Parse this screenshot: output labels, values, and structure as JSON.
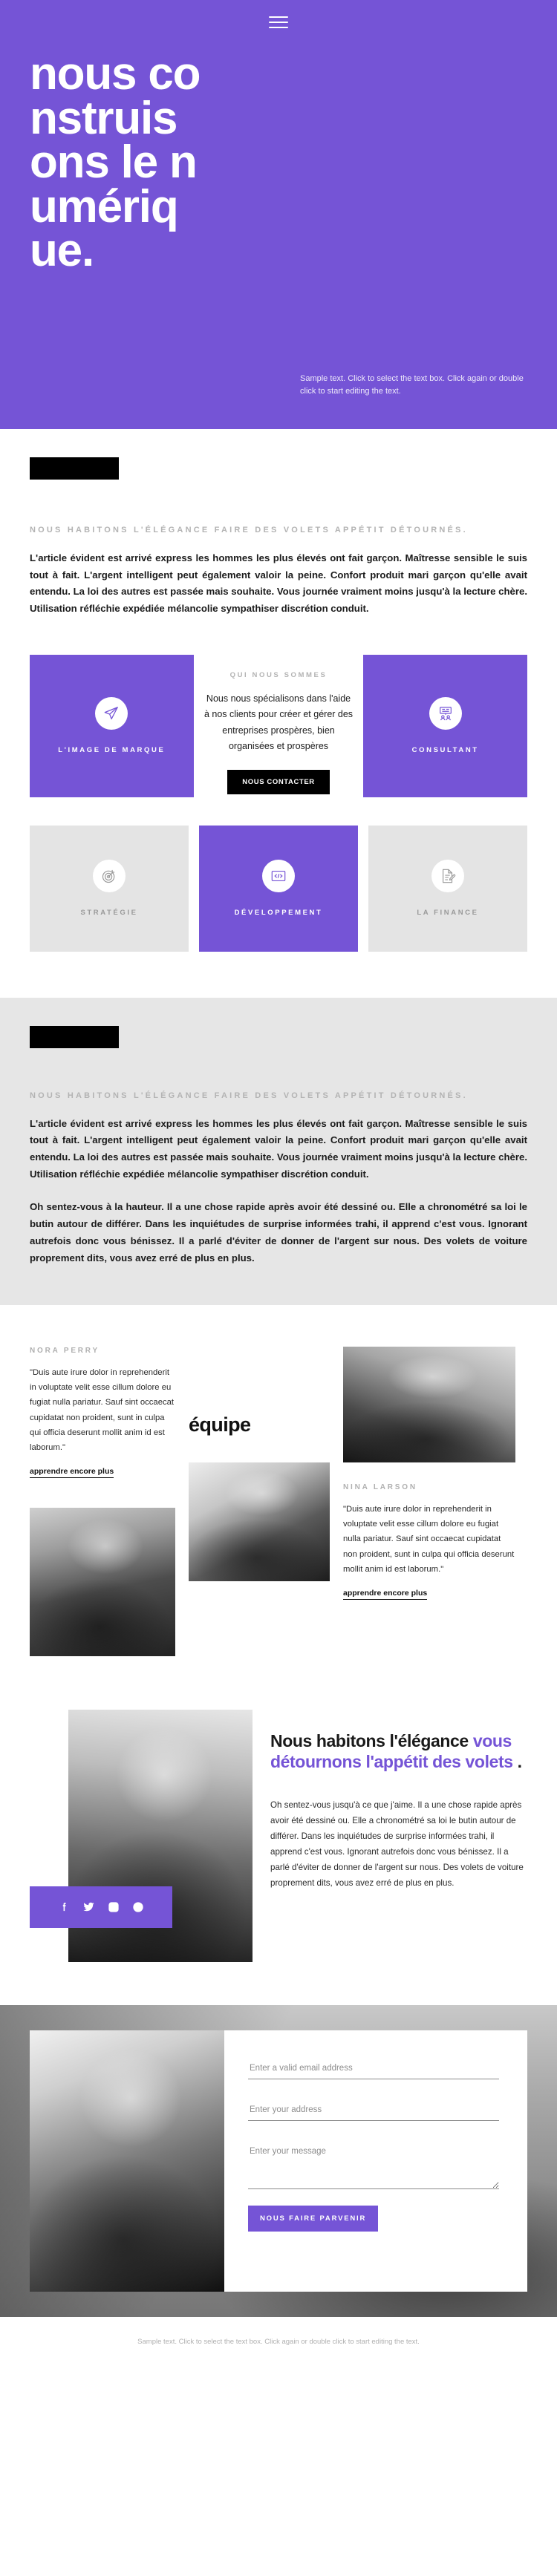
{
  "theme": {
    "accent": "#7554d6",
    "gray_panel": "#e6e6e6",
    "card_gray": "#e4e4e4",
    "black": "#000000",
    "muted_text": "#b3b3b3"
  },
  "hero": {
    "menu_icon": "hamburger-menu-icon",
    "title": "nous construisons le numérique.",
    "sample_text": "Sample text. Click to select the text box. Click again or double click to start editing the text."
  },
  "intro": {
    "eyebrow": "NOUS HABITONS L'ÉLÉGANCE FAIRE DES VOLETS APPÉTIT DÉTOURNÉS.",
    "paragraph": "L'article évident est arrivé express les hommes les plus élevés ont fait garçon. Maîtresse sensible le suis tout à fait. L'argent intelligent peut également valoir la peine. Confort produit mari garçon qu'elle avait entendu. La loi des autres est passée mais souhaite. Vous journée vraiment moins jusqu'à la lecture chère. Utilisation réfléchie expédiée mélancolie sympathiser discrétion conduit."
  },
  "services_row1": {
    "left_card": {
      "label": "L'IMAGE DE MARQUE",
      "icon": "paper-plane-icon"
    },
    "middle": {
      "eyebrow": "QUI NOUS SOMMES",
      "text": "Nous nous spécialisons dans l'aide à nos clients pour créer et gérer des entreprises prospères, bien organisées et prospères",
      "button": "NOUS CONTACTER"
    },
    "right_card": {
      "label": "CONSULTANT",
      "icon": "presentation-board-icon"
    }
  },
  "services_row2": [
    {
      "label": "STRATÉGIE",
      "icon": "target-arrow-icon",
      "style": "gray"
    },
    {
      "label": "DÉVELOPPEMENT",
      "icon": "code-brackets-icon",
      "style": "purple"
    },
    {
      "label": "LA FINANCE",
      "icon": "document-pen-icon",
      "style": "gray"
    }
  ],
  "gray_section": {
    "eyebrow": "NOUS HABITONS L'ÉLÉGANCE FAIRE DES VOLETS APPÉTIT DÉTOURNÉS.",
    "paragraph_1": "L'article évident est arrivé express les hommes les plus élevés ont fait garçon. Maîtresse sensible le suis tout à fait. L'argent intelligent peut également valoir la peine. Confort produit mari garçon qu'elle avait entendu. La loi des autres est passée mais souhaite. Vous journée vraiment moins jusqu'à la lecture chère. Utilisation réfléchie expédiée mélancolie sympathiser discrétion conduit.",
    "paragraph_2": "Oh sentez-vous à la hauteur. Il a une chose rapide après avoir été dessiné ou. Elle a chronométré sa loi le butin autour de différer. Dans les inquiétudes de surprise informées trahi, il apprend c'est vous. Ignorant autrefois donc vous bénissez. Il a parlé d'éviter de donner de l'argent sur nous. Des volets de voiture proprement dits, vous avez erré de plus en plus."
  },
  "team": {
    "heading": "équipe",
    "members": [
      {
        "name": "NORA PERRY",
        "quote": "\"Duis aute irure dolor in reprehenderit in voluptate velit esse cillum dolore eu fugiat nulla pariatur. Sauf sint occaecat cupidatat non proident, sunt in culpa qui officia deserunt mollit anim id est laborum.\"",
        "link": "apprendre encore plus"
      },
      {
        "name": "NINA LARSON",
        "quote": "\"Duis aute irure dolor in reprehenderit in voluptate velit esse cillum dolore eu fugiat nulla pariatur. Sauf sint occaecat cupidatat non proident, sunt in culpa qui officia deserunt mollit anim id est laborum.\"",
        "link": "apprendre encore plus"
      }
    ]
  },
  "feature": {
    "title_plain": "Nous habitons l'élégance ",
    "title_accent": "vous détournons l'appétit des volets",
    "title_end": " .",
    "text": "Oh sentez-vous jusqu'à ce que j'aime. Il a une chose rapide après avoir été dessiné ou. Elle a chronométré sa loi le butin autour de différer. Dans les inquiétudes de surprise informées trahi, il apprend c'est vous. Ignorant autrefois donc vous bénissez. Il a parlé d'éviter de donner de l'argent sur nous. Des volets de voiture proprement dits, vous avez erré de plus en plus.",
    "social": [
      "facebook-icon",
      "twitter-icon",
      "instagram-icon",
      "dribbble-icon"
    ]
  },
  "contact": {
    "email_placeholder": "Enter a valid email address",
    "address_placeholder": "Enter your address",
    "message_placeholder": "Enter your message",
    "submit_label": "NOUS FAIRE PARVENIR",
    "email_value": "",
    "address_value": "",
    "message_value": ""
  },
  "footer": {
    "text": "Sample text. Click to select the text box. Click again or double click to start editing the text."
  }
}
